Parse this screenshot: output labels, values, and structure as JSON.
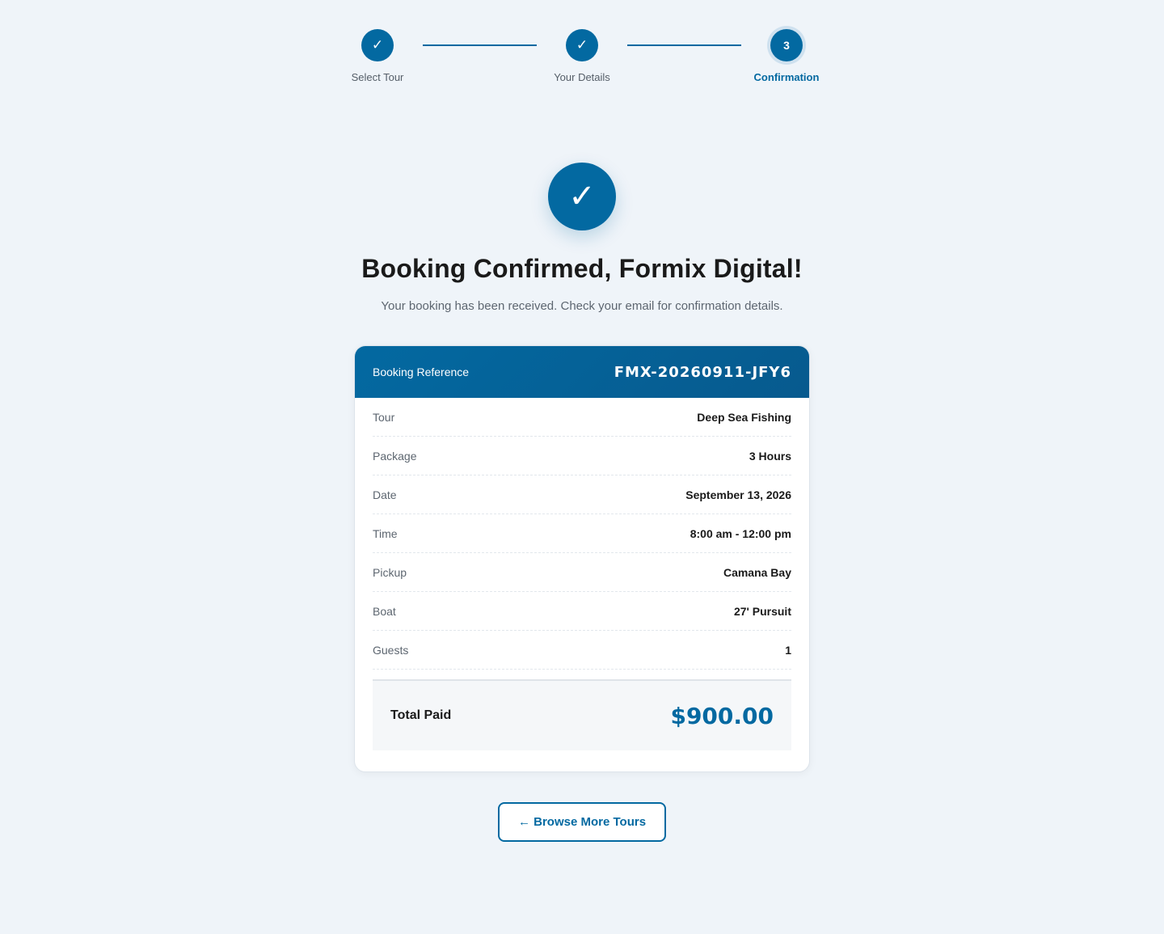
{
  "stepper": {
    "steps": [
      {
        "label": "Select Tour",
        "marker": "✓",
        "state": "completed"
      },
      {
        "label": "Your Details",
        "marker": "✓",
        "state": "completed"
      },
      {
        "label": "Confirmation",
        "marker": "3",
        "state": "active"
      }
    ]
  },
  "hero": {
    "icon": "check-icon",
    "icon_glyph": "✓",
    "title": "Booking Confirmed, Formix Digital!",
    "subtitle": "Your booking has been received. Check your email for confirmation details."
  },
  "booking": {
    "reference_label": "Booking Reference",
    "reference_value": "FMX-20260911-JFY6",
    "details": [
      {
        "label": "Tour",
        "value": "Deep Sea Fishing"
      },
      {
        "label": "Package",
        "value": "3 Hours"
      },
      {
        "label": "Date",
        "value": "September 13, 2026"
      },
      {
        "label": "Time",
        "value": "8:00 am - 12:00 pm"
      },
      {
        "label": "Pickup",
        "value": "Camana Bay"
      },
      {
        "label": "Boat",
        "value": "27' Pursuit"
      },
      {
        "label": "Guests",
        "value": "1"
      }
    ],
    "total_label": "Total Paid",
    "total_value": "$900.00"
  },
  "actions": {
    "browse_label": "← Browse More Tours"
  },
  "colors": {
    "accent": "#0369a1",
    "background": "#eff4f9",
    "card": "#ffffff",
    "muted_text": "#5d6670"
  }
}
